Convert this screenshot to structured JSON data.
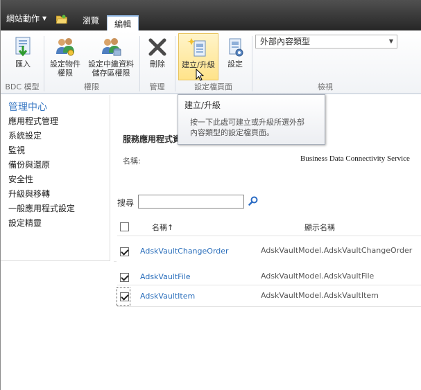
{
  "topbar": {
    "site_actions": "網站動作",
    "tabs": [
      "瀏覽",
      "編輯"
    ]
  },
  "ribbon": {
    "buttons": {
      "import": "匯入",
      "set_object_perms": [
        "設定物件",
        "權限"
      ],
      "set_metadata_perms": [
        "設定中繼資料",
        "儲存區權限"
      ],
      "delete": "刪除",
      "create_upgrade": "建立/升級",
      "settings": "設定"
    },
    "groups": {
      "bdc_model": "BDC 模型",
      "permissions": "權限",
      "manage": "管理",
      "profile_pages": "設定檔頁面",
      "view": "檢視"
    },
    "view_select": "外部內容類型"
  },
  "tooltip": {
    "title": "建立/升級",
    "body": [
      "按一下此處可建立或升級所選外部",
      "內容類型的設定檔頁面。"
    ]
  },
  "nav": {
    "heading": "管理中心",
    "items": [
      "應用程式管理",
      "系統設定",
      "監視",
      "備份與還原",
      "安全性",
      "升級與移轉",
      "一般應用程式設定",
      "設定精靈"
    ]
  },
  "main": {
    "service_title_visible": "服務應用程式資",
    "name_label": "名稱:",
    "name_value": "Business Data Connectivity Service",
    "search_label": "搜尋",
    "columns": {
      "name": "名稱",
      "sort_arrow": "↑",
      "display_name": "顯示名稱"
    },
    "rows": [
      {
        "name": "AdskVaultChangeOrder",
        "display_name": "AdskVaultModel.AdskVaultChangeOrder",
        "checked": true
      },
      {
        "name": "AdskVaultFile",
        "display_name": "AdskVaultModel.AdskVaultFile",
        "checked": true
      },
      {
        "name": "AdskVaultItem",
        "display_name": "AdskVaultModel.AdskVaultItem",
        "checked": true
      }
    ]
  },
  "colors": {
    "topbar": "#3a3a3a",
    "link": "#2a6ebb",
    "nav_heading": "#3b7ac4",
    "ribbon_highlight": "#ffe38a"
  },
  "icons": [
    "folder-icon",
    "import-icon",
    "people-key-icon",
    "people-db-icon",
    "delete-x-icon",
    "create-page-icon",
    "settings-page-icon",
    "search-icon",
    "cursor-arrow-icon"
  ]
}
